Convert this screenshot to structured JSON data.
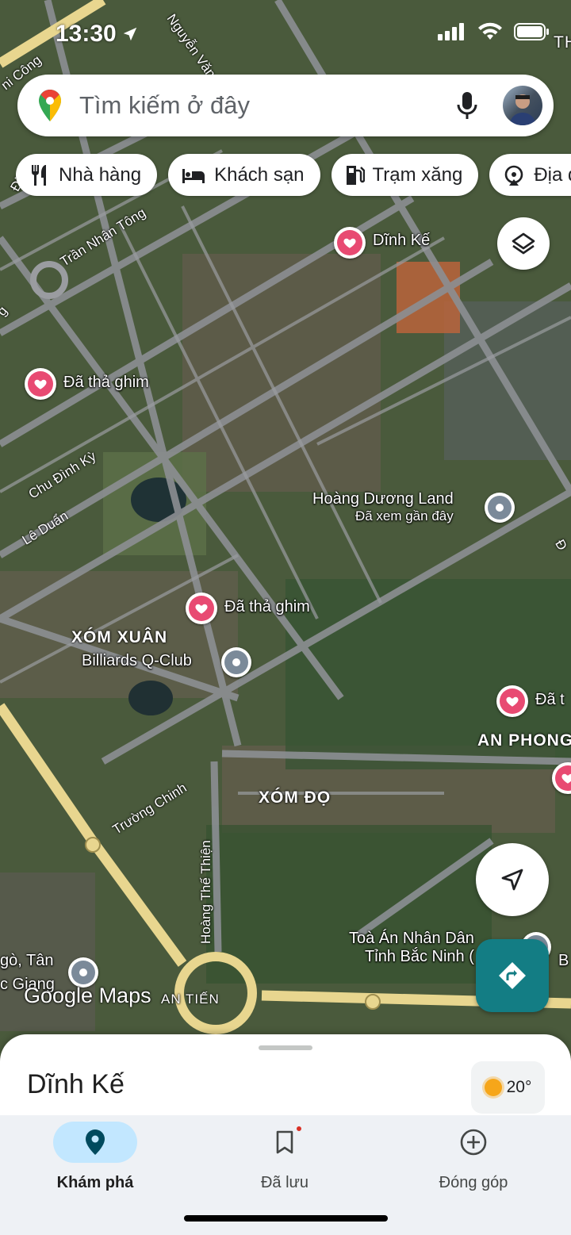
{
  "status_bar": {
    "time": "13:30"
  },
  "search": {
    "placeholder": "Tìm kiếm ở đây"
  },
  "chips": [
    {
      "label": "Nhà hàng",
      "icon": "restaurant-icon"
    },
    {
      "label": "Khách sạn",
      "icon": "hotel-icon"
    },
    {
      "label": "Trạm xăng",
      "icon": "gas-station-icon"
    },
    {
      "label": "Địa d",
      "icon": "attraction-icon"
    }
  ],
  "map": {
    "places": {
      "dinh_ke": "Dĩnh Kế",
      "pinned_1": "Đã thả ghim",
      "pinned_2": "Đã thả ghim",
      "pinned_3": "Đã t",
      "hoang_duong": "Hoàng Dương Land",
      "hoang_duong_sub": "Đã xem gần đây",
      "billiards": "Billiards Q-Club",
      "toa_an_1": "Toà Án Nhân Dân",
      "toa_an_2": "Tỉnh Bắc Ninh (",
      "left_place_1": "gò, Tân",
      "left_place_2": "c Giang",
      "right_edge_b": "B"
    },
    "areas": {
      "xom_xuan": "XÓM XUÂN",
      "xom_do": "XÓM ĐỌ",
      "an_phong": "AN PHONG",
      "an_tien": "AN TIẾN",
      "th_edge": "TH"
    },
    "roads": {
      "nguyen_van_linh": "Nguyễn Văn Li",
      "tran_nhan_tong": "Trần Nhân Tông",
      "chu_dinh_ky": "Chu Đình Kỳ",
      "le_duan": "Lê Duẩn",
      "truong_chinh": "Trường Chinh",
      "hoang_the_thien": "Hoàng Thế Thiện",
      "cong": "ni Công",
      "dinh": "Đinh",
      "edge_g": "g",
      "edge_d": "Đ"
    },
    "logo": "Google Maps"
  },
  "sheet": {
    "title": "Dĩnh Kế",
    "temperature": "20°"
  },
  "nav": [
    {
      "label": "Khám phá",
      "icon": "explore-pin-icon",
      "active": true
    },
    {
      "label": "Đã lưu",
      "icon": "bookmark-icon",
      "active": false
    },
    {
      "label": "Đóng góp",
      "icon": "add-circle-icon",
      "active": false
    }
  ],
  "colors": {
    "heart_pin": "#e84a72",
    "directions": "#137d84",
    "nav_active": "#c2e7ff",
    "sun": "#f6a61a"
  }
}
